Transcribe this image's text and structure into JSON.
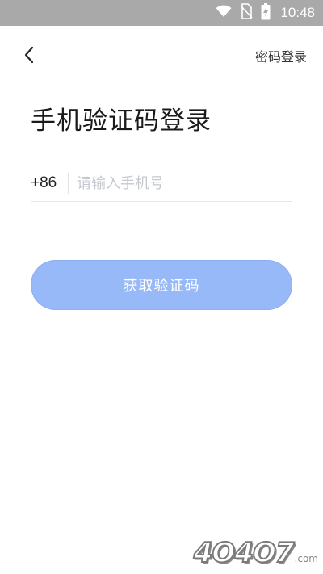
{
  "status_bar": {
    "time": "10:48",
    "icons": [
      "wifi-icon",
      "no-sim-icon",
      "battery-charging-icon"
    ]
  },
  "nav": {
    "back_icon": "chevron-left-icon",
    "password_login": "密码登录"
  },
  "page": {
    "title": "手机验证码登录"
  },
  "phone": {
    "country_code": "+86",
    "placeholder": "请输入手机号",
    "value": ""
  },
  "actions": {
    "get_code": "获取验证码"
  },
  "watermark": {
    "text": "4O4O7",
    "suffix": ".com"
  },
  "colors": {
    "status_bar": "#a9a9a9",
    "button": "#98b9f7",
    "placeholder": "#c4c8cf"
  }
}
